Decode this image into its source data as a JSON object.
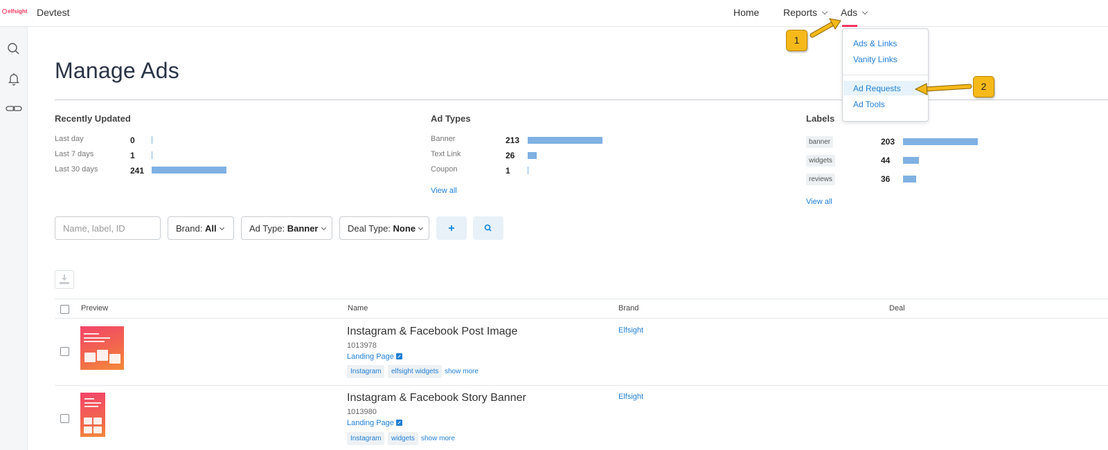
{
  "header": {
    "logo_text": "elfsight",
    "app_title": "Devtest",
    "nav": [
      {
        "label": "Home"
      },
      {
        "label": "Reports"
      },
      {
        "label": "Ads"
      }
    ],
    "accent_color": "#f0355d"
  },
  "sidebar": {
    "icons": [
      "search-icon",
      "bell-icon",
      "link-icon"
    ]
  },
  "ads_menu": {
    "items": [
      {
        "label": "Ads & Links"
      },
      {
        "label": "Vanity Links"
      },
      {
        "label": "Ad Requests"
      },
      {
        "label": "Ad Tools"
      }
    ],
    "highlighted": "Ad Requests"
  },
  "callouts": [
    "1",
    "2"
  ],
  "page": {
    "title": "Manage Ads"
  },
  "stats": {
    "recently_updated": {
      "title": "Recently Updated",
      "rows": [
        {
          "label": "Last day",
          "value": "0"
        },
        {
          "label": "Last 7 days",
          "value": "1"
        },
        {
          "label": "Last 30 days",
          "value": "241"
        }
      ]
    },
    "ad_types": {
      "title": "Ad Types",
      "rows": [
        {
          "label": "Banner",
          "value": "213"
        },
        {
          "label": "Text Link",
          "value": "26"
        },
        {
          "label": "Coupon",
          "value": "1"
        }
      ],
      "view_all": "View all"
    },
    "labels": {
      "title": "Labels",
      "rows": [
        {
          "label": "banner",
          "value": "203"
        },
        {
          "label": "widgets",
          "value": "44"
        },
        {
          "label": "reviews",
          "value": "36"
        }
      ],
      "view_all": "View all"
    }
  },
  "filters": {
    "search_placeholder": "Name, label, ID",
    "brand": {
      "label": "Brand:",
      "value": "All"
    },
    "ad_type": {
      "label": "Ad Type:",
      "value": "Banner"
    },
    "deal_type": {
      "label": "Deal Type:",
      "value": "None"
    }
  },
  "table": {
    "columns": [
      "Preview",
      "Name",
      "Brand",
      "Deal"
    ],
    "rows": [
      {
        "name": "Instagram & Facebook Post Image",
        "id": "1013978",
        "link": "Landing Page",
        "tags": [
          "Instagram",
          "elfsight widgets"
        ],
        "show_more": "show more",
        "brand": "Elfsight"
      },
      {
        "name": "Instagram & Facebook Story Banner",
        "id": "1013980",
        "link": "Landing Page",
        "tags": [
          "Instagram",
          "widgets"
        ],
        "show_more": "show more",
        "brand": "Elfsight"
      }
    ]
  }
}
